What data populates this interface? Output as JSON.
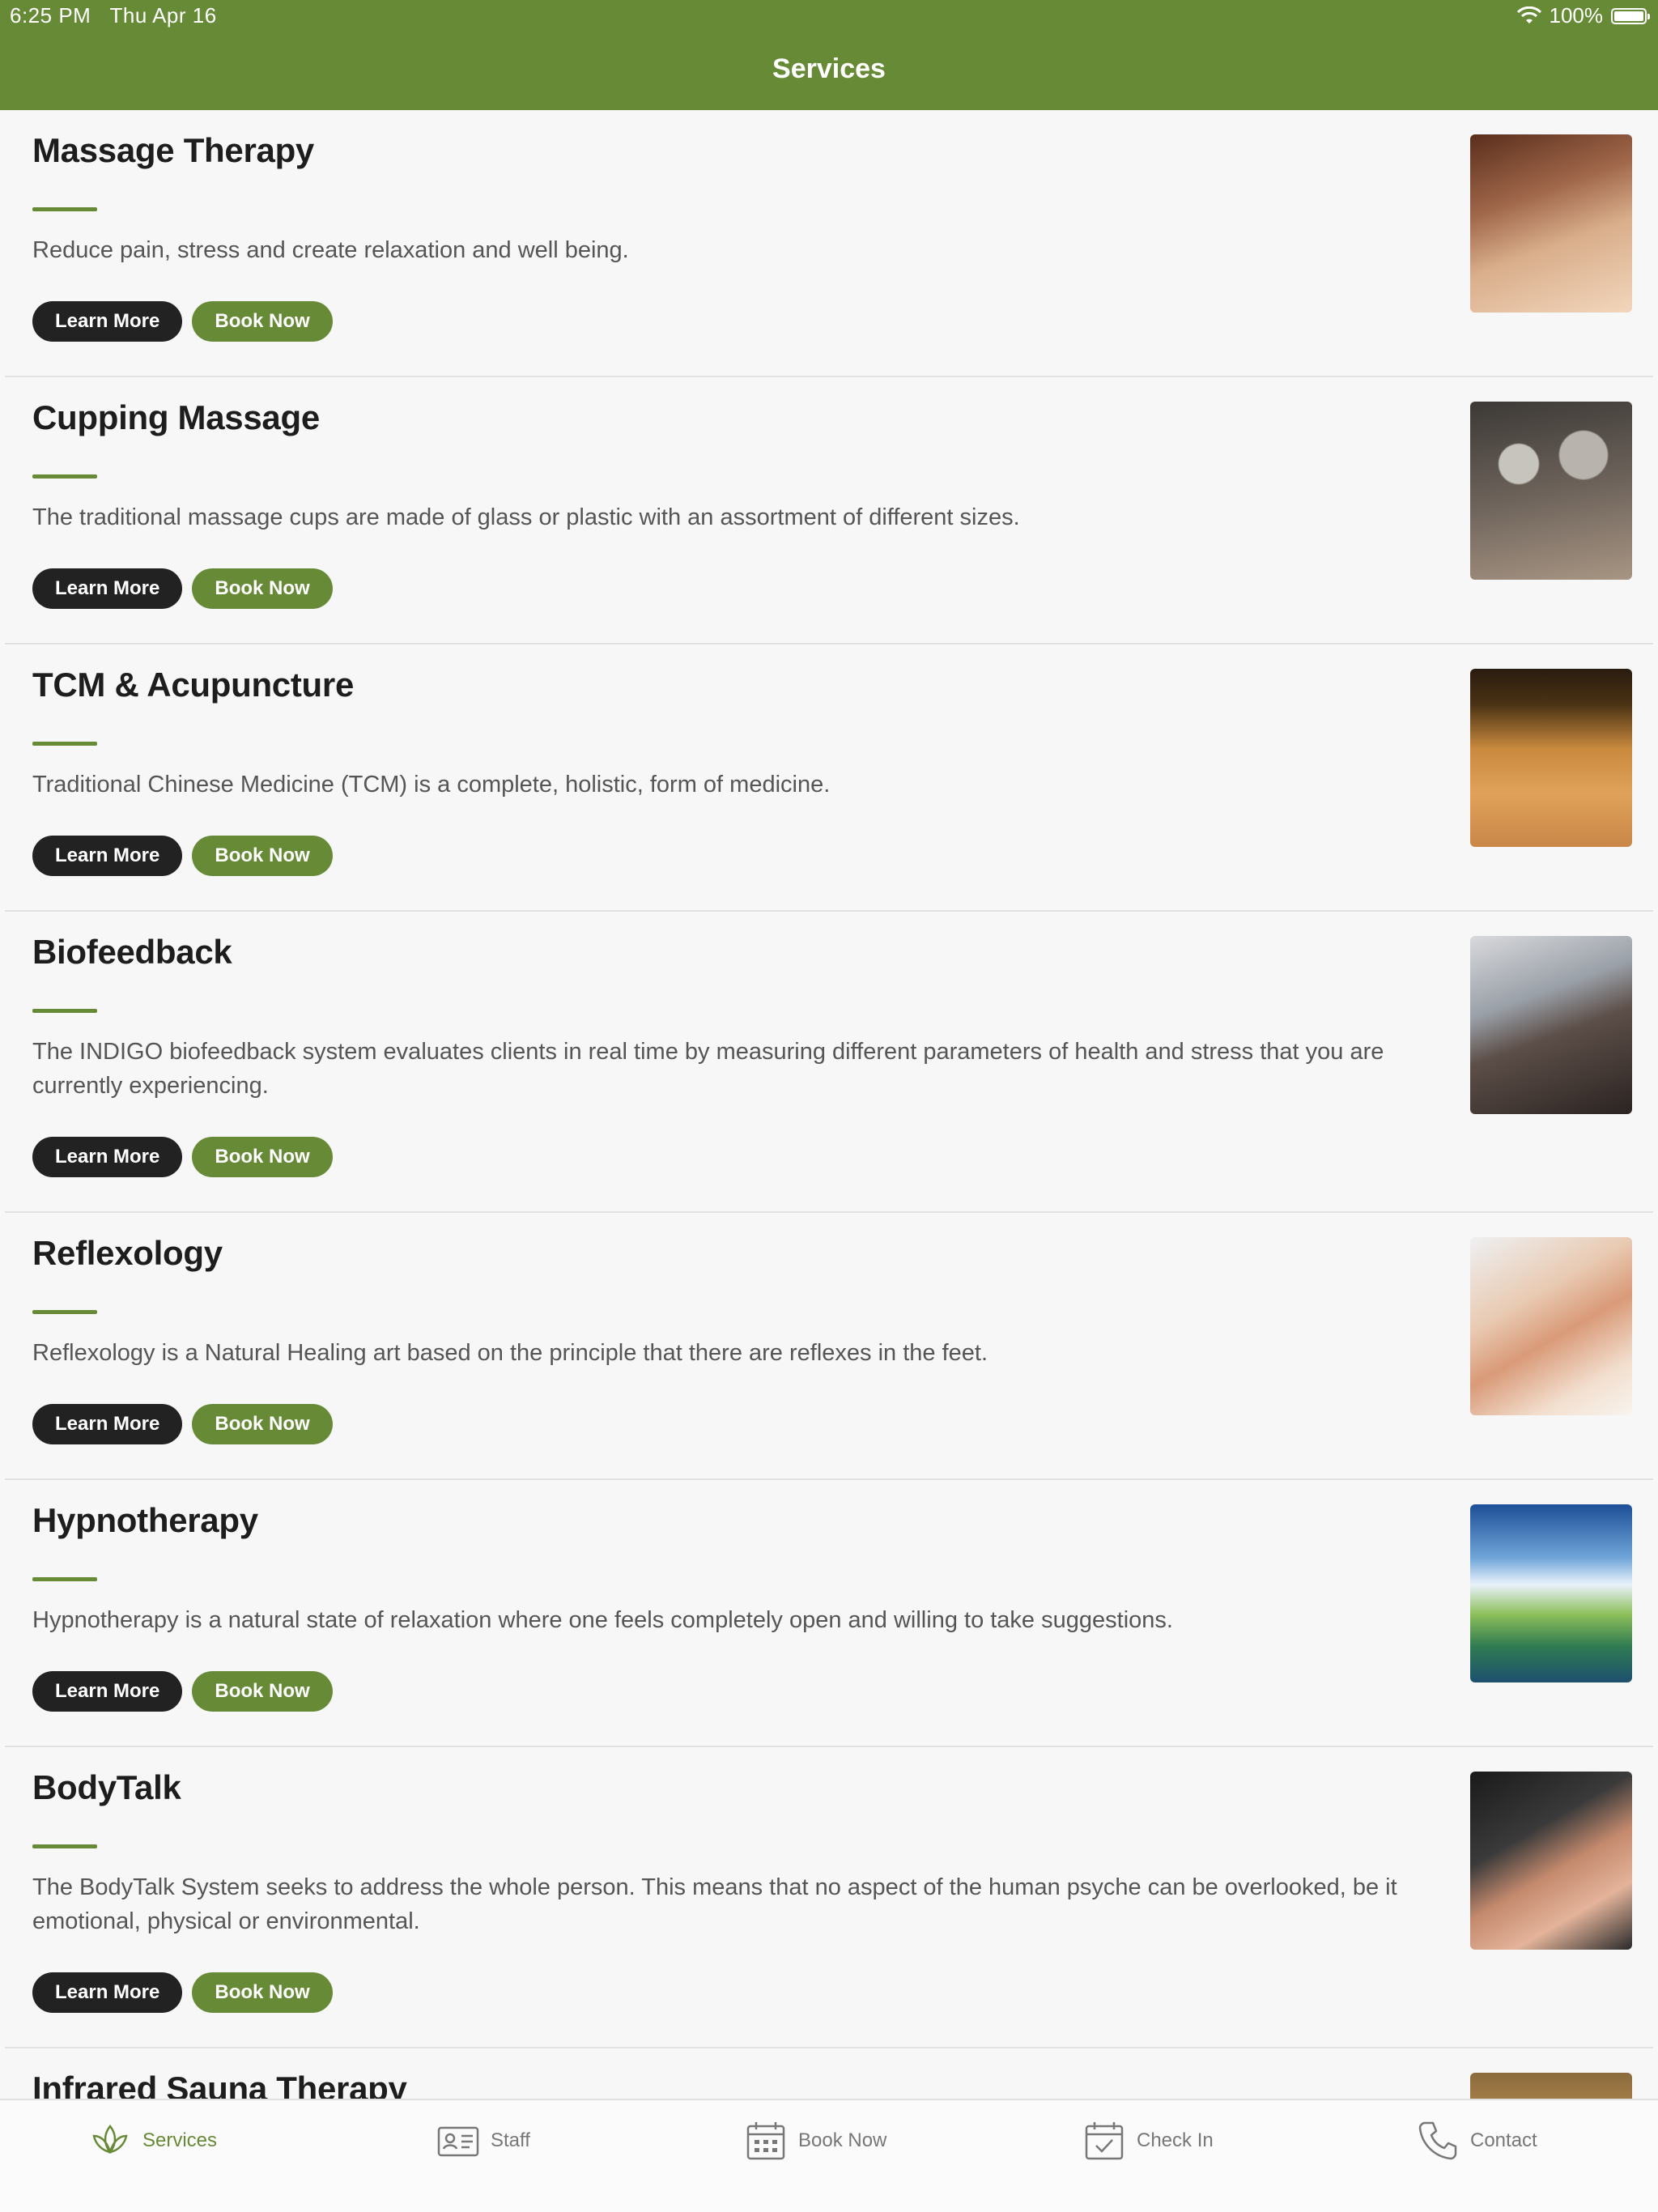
{
  "status": {
    "time": "6:25 PM",
    "date": "Thu Apr 16",
    "battery": "100%",
    "battery_level": 1.0
  },
  "header": {
    "title": "Services"
  },
  "buttons": {
    "learn_more": "Learn More",
    "book_now": "Book Now"
  },
  "services": [
    {
      "title": "Massage Therapy",
      "description": "Reduce pain, stress and create relaxation and well being."
    },
    {
      "title": "Cupping Massage",
      "description": "The traditional massage cups are made of glass or plastic with an assortment of different sizes."
    },
    {
      "title": "TCM & Acupuncture",
      "description": "Traditional Chinese Medicine (TCM) is a complete, holistic, form of medicine."
    },
    {
      "title": "Biofeedback",
      "description": "The INDIGO biofeedback system evaluates clients in real time by measuring different parameters of health and stress that you are currently experiencing."
    },
    {
      "title": "Reflexology",
      "description": "Reflexology is a Natural Healing art based on the principle that there are reflexes in the feet."
    },
    {
      "title": "Hypnotherapy",
      "description": "Hypnotherapy is a natural state of relaxation where one feels completely open and willing to take suggestions."
    },
    {
      "title": "BodyTalk",
      "description": "The BodyTalk System seeks to address the whole person. This means that no aspect of the human psyche can be overlooked, be it emotional, physical or environmental."
    },
    {
      "title": "Infrared Sauna Therapy",
      "description": ""
    }
  ],
  "tabs": [
    {
      "label": "Services",
      "icon": "lotus-icon",
      "active": true
    },
    {
      "label": "Staff",
      "icon": "id-card-icon",
      "active": false
    },
    {
      "label": "Book Now",
      "icon": "calendar-icon",
      "active": false
    },
    {
      "label": "Check In",
      "icon": "calendar-check-icon",
      "active": false
    },
    {
      "label": "Contact",
      "icon": "phone-icon",
      "active": false
    }
  ],
  "colors": {
    "brand": "#678a37",
    "dark_button": "#222222",
    "background": "#f7f7f7"
  }
}
